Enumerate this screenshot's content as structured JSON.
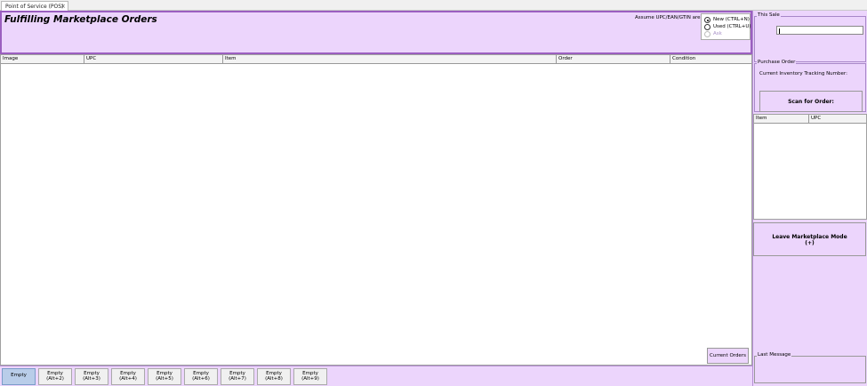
{
  "tab": {
    "label": "Point of Service (POS)",
    "close": "×"
  },
  "header": {
    "title": "Fulfilling Marketplace Orders",
    "assume_label": "Assume UPC/EAN/GTIN are:",
    "options": [
      {
        "label": "New (CTRL+N)",
        "checked": true,
        "disabled": false
      },
      {
        "label": "Used (CTRL+U)",
        "checked": false,
        "disabled": false
      },
      {
        "label": "Ask",
        "checked": false,
        "disabled": true
      }
    ]
  },
  "grid": {
    "columns": [
      "Image",
      "UPC",
      "Item",
      "Order",
      "Condition"
    ],
    "rows": []
  },
  "current_orders_label": "Current Orders",
  "quick_slots": [
    {
      "label": "Empty",
      "shortcut": ""
    },
    {
      "label": "Empty",
      "shortcut": "(Alt+2)"
    },
    {
      "label": "Empty",
      "shortcut": "(Alt+3)"
    },
    {
      "label": "Empty",
      "shortcut": "(Alt+4)"
    },
    {
      "label": "Empty",
      "shortcut": "(Alt+5)"
    },
    {
      "label": "Empty",
      "shortcut": "(Alt+6)"
    },
    {
      "label": "Empty",
      "shortcut": "(Alt+7)"
    },
    {
      "label": "Empty",
      "shortcut": "(Alt+8)"
    },
    {
      "label": "Empty",
      "shortcut": "(Alt+9)"
    }
  ],
  "sidebar": {
    "this_sale": {
      "legend": "This Sale",
      "value": ""
    },
    "purchase_order": {
      "legend": "Purchase Order",
      "tracking_label": "Current Inventory Tracking Number:",
      "scan_label": "Scan for Order:"
    },
    "order_grid": {
      "columns": [
        "Item",
        "UPC"
      ]
    },
    "leave_label": "Leave Marketplace Mode",
    "leave_shortcut": "(+)",
    "last_message": {
      "legend": "Last Message",
      "value": ""
    }
  },
  "colors": {
    "panel": "#ecd5fc",
    "header_border": "#9b5fc0",
    "active_slot": "#b9cde9"
  }
}
